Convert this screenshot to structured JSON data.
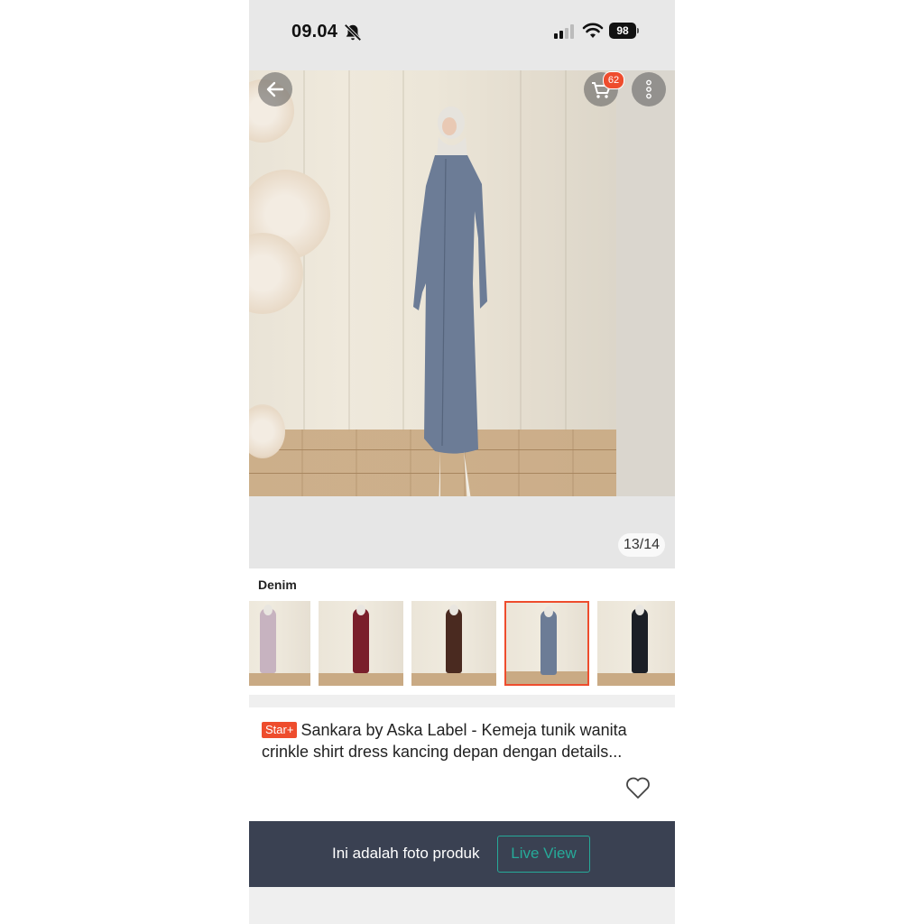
{
  "status_bar": {
    "time": "09.04",
    "battery": "98",
    "icons": [
      "bell-muted-icon",
      "signal-icon",
      "wifi-icon",
      "battery-icon"
    ]
  },
  "gallery": {
    "counter": "13/14",
    "cart_count": "62",
    "icons": [
      "back-arrow-icon",
      "cart-icon",
      "more-vertical-icon"
    ]
  },
  "variant": {
    "label": "Denim",
    "selected_index": 3,
    "thumbnails": [
      {
        "color": "#c7b3c0"
      },
      {
        "color": "#7a1f2b"
      },
      {
        "color": "#4a2a20"
      },
      {
        "color": "#6c7c96"
      },
      {
        "color": "#1c1f26"
      }
    ]
  },
  "product": {
    "badge": "Star+",
    "title": "Sankara by Aska Label - Kemeja tunik wanita crinkle shirt dress kancing depan dengan details...",
    "icons": [
      "heart-icon"
    ]
  },
  "bottom_bar": {
    "text": "Ini adalah foto produk",
    "button": "Live View"
  },
  "colors": {
    "accent": "#ee4d2d",
    "teal": "#26aa99",
    "bottom_bar_bg": "#3a4152",
    "dress": "#6c7c96"
  }
}
